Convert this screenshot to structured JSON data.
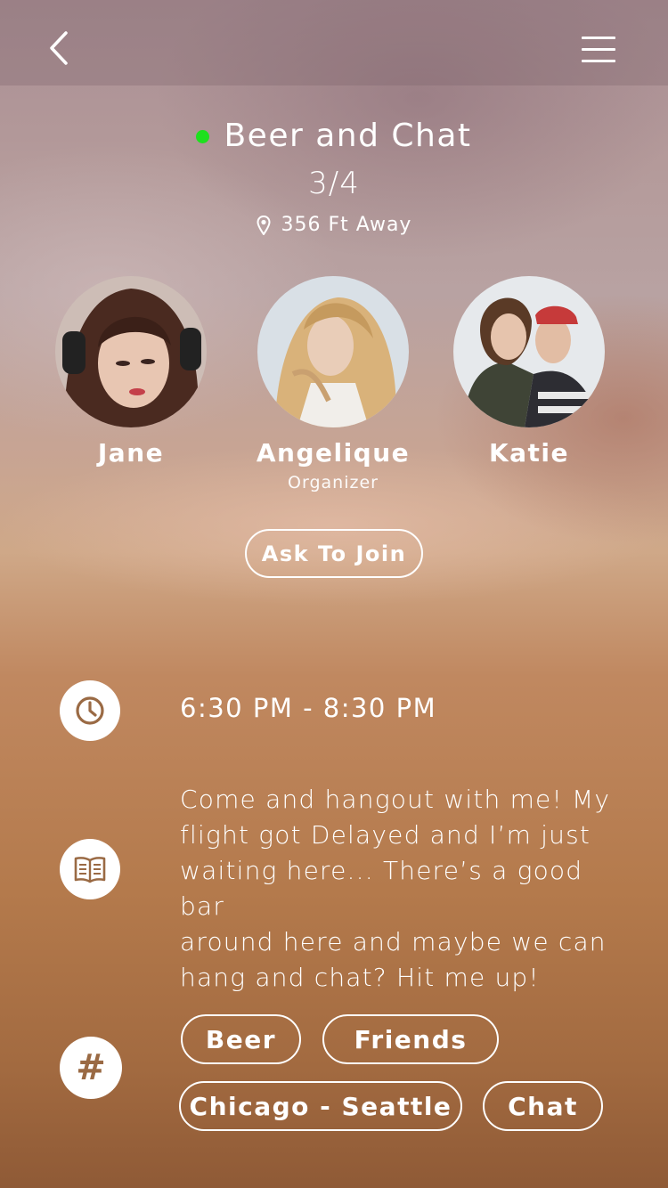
{
  "event": {
    "title": "Beer and Chat",
    "count": "3/4",
    "distance": "356 Ft Away",
    "status_color": "#1ee01e"
  },
  "people": [
    {
      "name": "Jane",
      "role": ""
    },
    {
      "name": "Angelique",
      "role": "Organizer"
    },
    {
      "name": "Katie",
      "role": ""
    }
  ],
  "join_button": "Ask To Join",
  "details": {
    "time": "6:30 PM - 8:30 PM",
    "description_lines": [
      "Come and hangout with me! My",
      "flight got Delayed and I’m just",
      "waiting here... There’s a good bar",
      "around here and maybe we can",
      "hang and chat? Hit me up!"
    ],
    "hash_symbol": "#"
  },
  "tags": [
    "Beer",
    "Friends",
    "Chicago - Seattle",
    "Chat"
  ],
  "icons": {
    "back": "chevron-left-icon",
    "menu": "hamburger-menu-icon",
    "location": "map-pin-icon",
    "time": "clock-icon",
    "description": "book-icon",
    "tags": "hashtag-icon"
  },
  "colors": {
    "accent_icon": "#9a6a44"
  }
}
